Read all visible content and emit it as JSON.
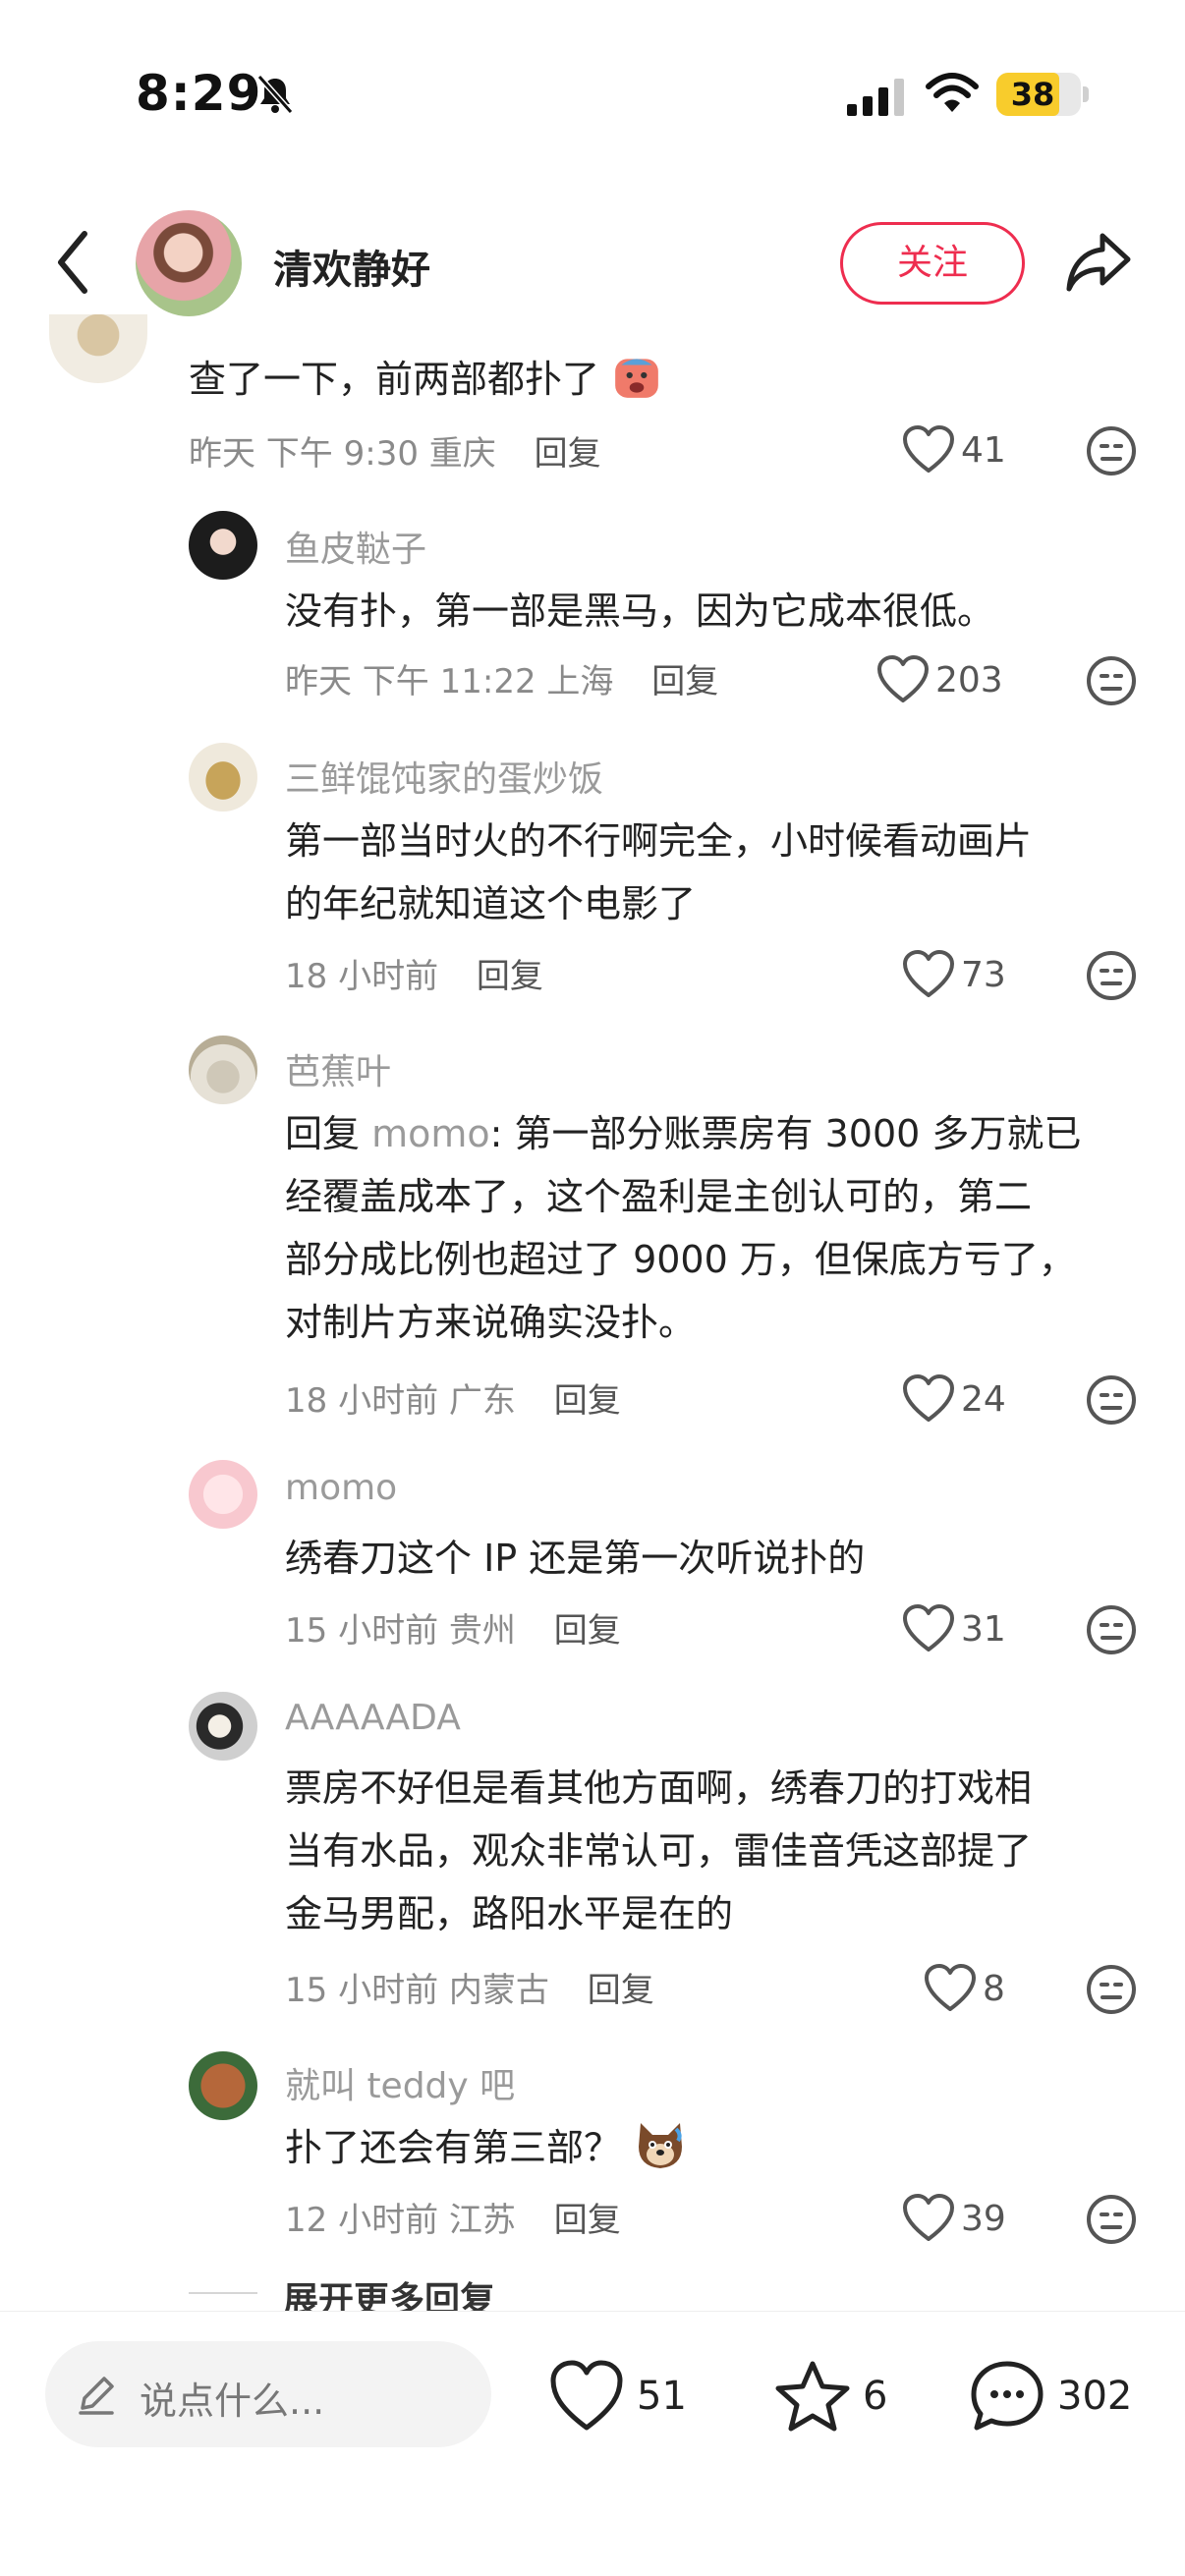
{
  "status_bar": {
    "time": "8:29",
    "battery": "38",
    "icons": [
      "bell-muted-icon",
      "signal-icon",
      "wifi-icon",
      "battery-icon"
    ]
  },
  "header": {
    "name": "清欢静好",
    "follow_label": "关注",
    "icons": [
      "back-icon",
      "share-icon"
    ]
  },
  "comments": [
    {
      "text": "查了一下，前两部都扑了",
      "time": "昨天 下午 9:30",
      "location": "重庆",
      "reply_label": "回复",
      "likes": "41"
    },
    {
      "name": "鱼皮鞑子",
      "text": "没有扑，第一部是黑马，因为它成本很低。",
      "time": "昨天 下午 11:22",
      "location": "上海",
      "reply_label": "回复",
      "likes": "203"
    },
    {
      "name": "三鲜馄饨家的蛋炒饭",
      "text_lines": [
        "第一部当时火的不行啊完全，小时候看动画片",
        "的年纪就知道这个电影了"
      ],
      "time": "18 小时前",
      "location": "",
      "reply_label": "回复",
      "likes": "73"
    },
    {
      "name": "芭蕉叶",
      "reply_prefix": "回复 ",
      "reply_target": "momo",
      "text_lines": [
        ": 第一部分账票房有 3000 多万就已",
        "经覆盖成本了，这个盈利是主创认可的，第二",
        "部分成比例也超过了 9000 万，但保底方亏了，",
        "对制片方来说确实没扑。"
      ],
      "time": "18 小时前",
      "location": "广东",
      "reply_label": "回复",
      "likes": "24"
    },
    {
      "name": "momo",
      "text": "绣春刀这个 IP 还是第一次听说扑的",
      "time": "15 小时前",
      "location": "贵州",
      "reply_label": "回复",
      "likes": "31"
    },
    {
      "name": "AAAAADA",
      "text_lines": [
        "票房不好但是看其他方面啊，绣春刀的打戏相",
        "当有水品，观众非常认可，雷佳音凭这部提了",
        "金马男配，路阳水平是在的"
      ],
      "time": "15 小时前",
      "location": "内蒙古",
      "reply_label": "回复",
      "likes": "8"
    },
    {
      "name": "就叫 teddy 吧",
      "text": "扑了还会有第三部？",
      "time": "12 小时前",
      "location": "江苏",
      "reply_label": "回复",
      "likes": "39"
    }
  ],
  "more_replies": "展开更多回复",
  "bottom_bar": {
    "placeholder": "说点什么...",
    "likes": "51",
    "stars": "6",
    "comments": "302"
  },
  "colors": {
    "accent": "#ee2d4f",
    "meta": "#8a8a8a",
    "battery": "#f8cc2c"
  }
}
